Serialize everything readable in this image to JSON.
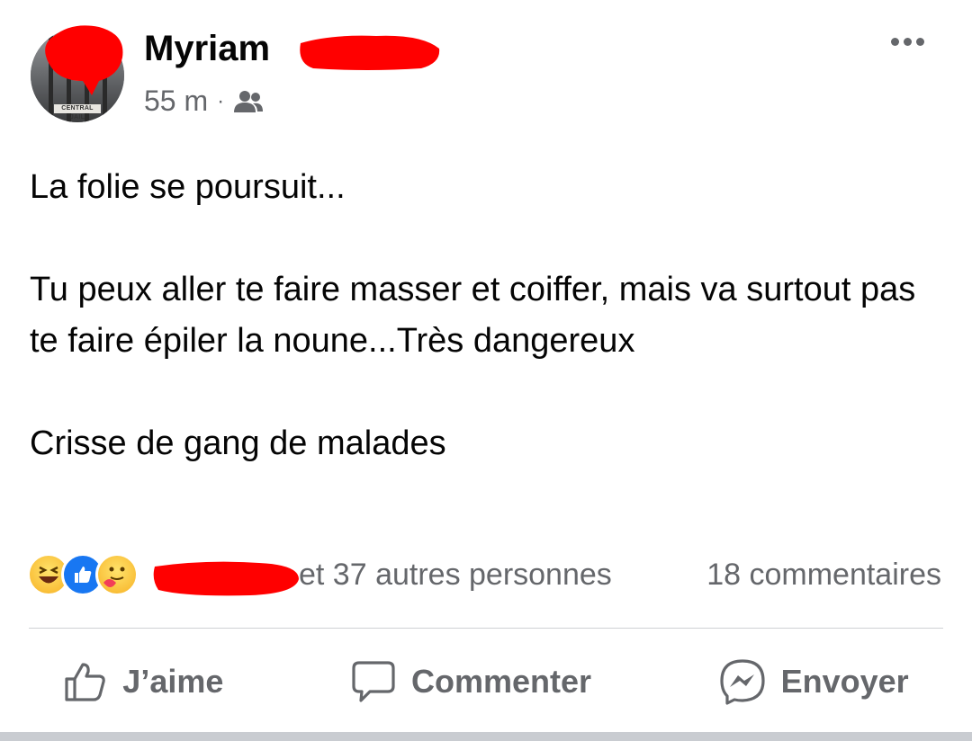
{
  "post": {
    "author": "Myriam",
    "timestamp": "55 m",
    "separator": "·",
    "audience_icon": "friends-icon",
    "avatar_caption": "CENTRAL JAIL",
    "body": [
      "La folie se poursuit...",
      "Tu peux aller te faire masser et coiffer, mais va surtout pas te faire épiler la noune...Très dangereux",
      "Crisse de gang de malades"
    ]
  },
  "engagement": {
    "reactions": [
      "haha-icon",
      "like-icon",
      "care-icon"
    ],
    "reactors_text": "et 37 autres personnes",
    "comments_text": "18 commentaires"
  },
  "actions": {
    "like_label": "J’aime",
    "comment_label": "Commenter",
    "share_label": "Envoyer"
  },
  "colors": {
    "text": "#050505",
    "secondary": "#65676b",
    "like_blue": "#1877f2",
    "redaction": "#ff0000"
  }
}
